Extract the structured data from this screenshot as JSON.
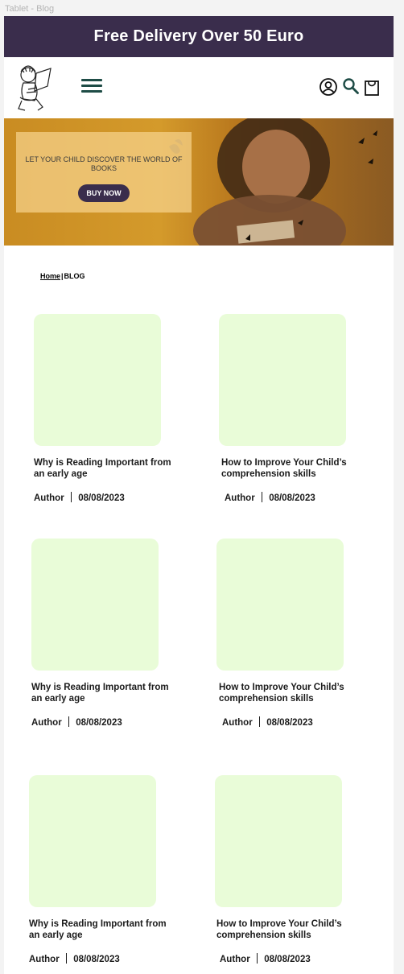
{
  "frame_label": "Tablet - Blog",
  "promo": {
    "text": "Free Delivery Over 50 Euro"
  },
  "header": {
    "icons": [
      "menu-icon",
      "account-icon",
      "search-icon",
      "cart-icon"
    ],
    "colors": {
      "icon": "#1e4c46",
      "brand": "#3a2d4c"
    }
  },
  "hero": {
    "text": "LET YOUR CHILD DISCOVER THE WORLD OF BOOKS",
    "button": "BUY NOW"
  },
  "breadcrumb": {
    "home": "Home",
    "separator": "|",
    "current": "BLOG"
  },
  "posts": [
    {
      "title": "Why is Reading Important from an early age",
      "author": "Author",
      "date": "08/08/2023"
    },
    {
      "title": "How to  Improve Your Child’s comprehension skills",
      "author": "Author",
      "date": "08/08/2023"
    },
    {
      "title": "Why is Reading Important from an early age",
      "author": "Author",
      "date": "08/08/2023"
    },
    {
      "title": "How to  Improve Your Child’s comprehension skills",
      "author": "Author",
      "date": "08/08/2023"
    },
    {
      "title": "Why is Reading Important from an early age",
      "author": "Author",
      "date": "08/08/2023"
    },
    {
      "title": "How to  Improve Your Child’s comprehension skills",
      "author": "Author",
      "date": "08/08/2023"
    }
  ]
}
